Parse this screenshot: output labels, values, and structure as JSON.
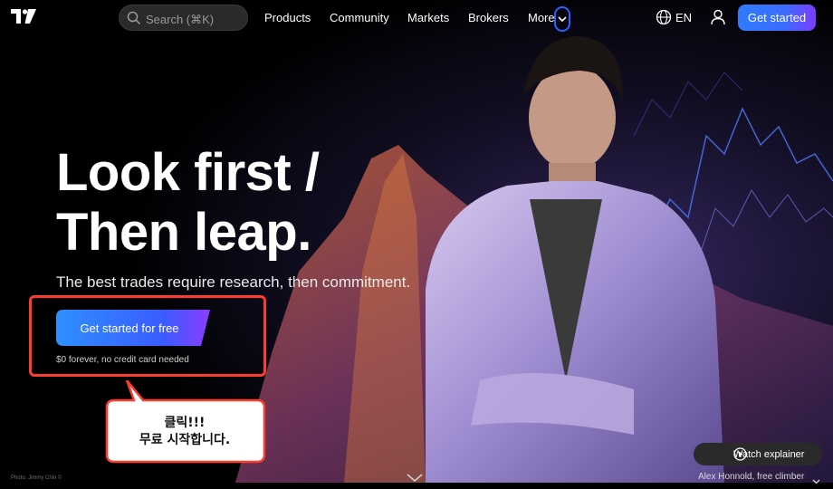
{
  "nav": {
    "search_placeholder": "Search (⌘K)",
    "items": [
      "Products",
      "Community",
      "Markets",
      "Brokers",
      "More"
    ],
    "language": "EN",
    "cta_label": "Get started"
  },
  "hero": {
    "headline_line1": "Look first /",
    "headline_line2": "Then leap.",
    "subheading": "The best trades require research, then commitment.",
    "cta_label": "Get started for free",
    "cta_note": "$0 forever, no credit card needed"
  },
  "annotation": {
    "line1": "클릭!!!",
    "line2": "무료 시작합니다.",
    "highlight_color": "#ff3b2f"
  },
  "footer": {
    "photo_credit": "Photo: Jimmy Chin ©",
    "watch_label": "Watch explainer",
    "caption": "Alex Honnold, free climber"
  },
  "colors": {
    "accent": "#2962ff",
    "cta_gradient_end": "#7c3cff"
  },
  "icons": [
    "tradingview-logo-icon",
    "search-icon",
    "chevron-down-icon",
    "globe-icon",
    "user-icon",
    "play-icon",
    "scroll-down-icon"
  ]
}
